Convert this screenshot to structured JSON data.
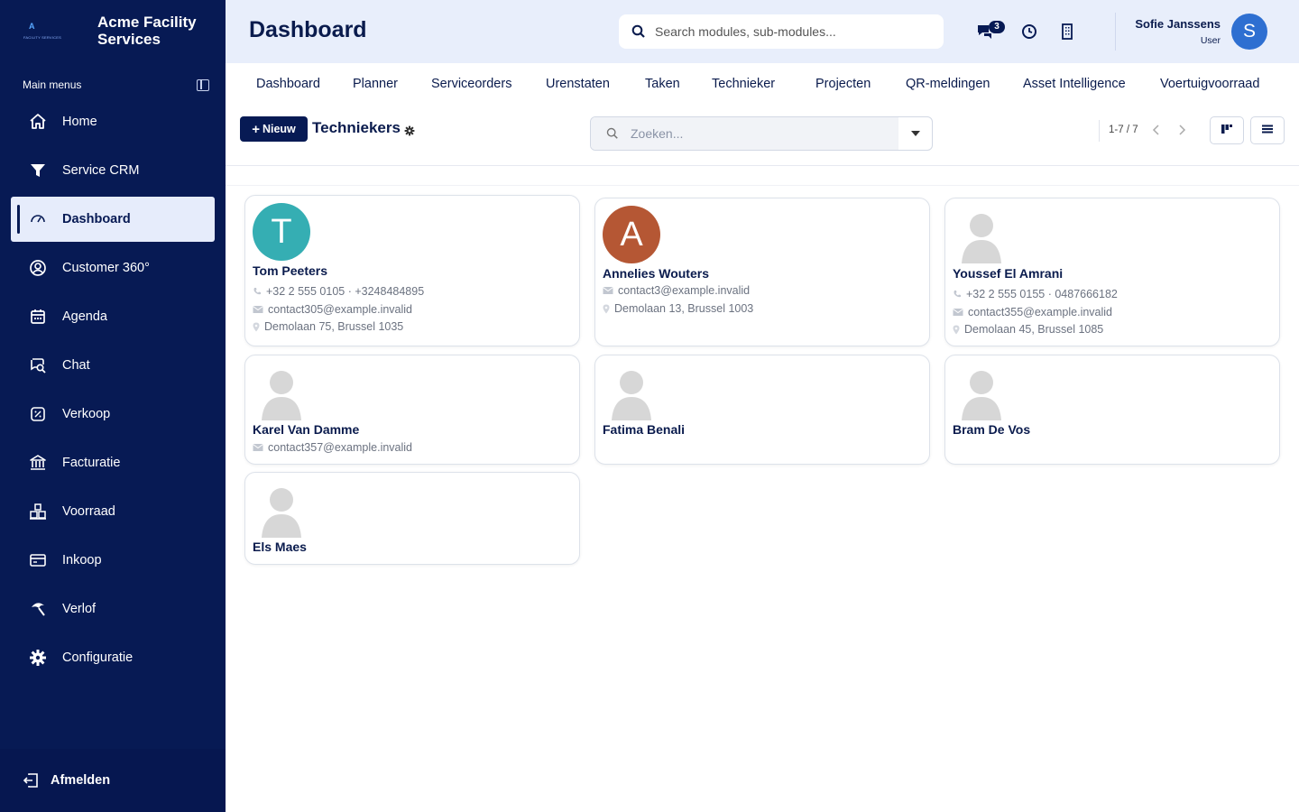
{
  "brand": {
    "logo_mark": "A",
    "logo_subtext": "FACILITY SERVICES",
    "name": "Acme Facility Services"
  },
  "sidebar": {
    "heading": "Main menus",
    "items": [
      {
        "label": "Home",
        "icon": "home-icon"
      },
      {
        "label": "Service CRM",
        "icon": "filter-icon"
      },
      {
        "label": "Dashboard",
        "icon": "gauge-icon",
        "active": true
      },
      {
        "label": "Customer 360°",
        "icon": "user-circle-icon"
      },
      {
        "label": "Agenda",
        "icon": "calendar-icon"
      },
      {
        "label": "Chat",
        "icon": "chat-search-icon"
      },
      {
        "label": "Verkoop",
        "icon": "percent-icon"
      },
      {
        "label": "Facturatie",
        "icon": "bank-icon"
      },
      {
        "label": "Voorraad",
        "icon": "boxes-icon"
      },
      {
        "label": "Inkoop",
        "icon": "card-icon"
      },
      {
        "label": "Verlof",
        "icon": "umbrella-icon"
      },
      {
        "label": "Configuratie",
        "icon": "gear-icon"
      }
    ],
    "logout_label": "Afmelden"
  },
  "header": {
    "title": "Dashboard",
    "search_placeholder": "Search modules, sub-modules...",
    "chat_badge": "3",
    "user_name": "Sofie Janssens",
    "user_role": "User",
    "avatar_initial": "S"
  },
  "tabs": [
    "Dashboard",
    "Planner",
    "Serviceorders",
    "Urenstaten",
    "Taken",
    "Technieker",
    "Projecten",
    "QR-meldingen",
    "Asset Intelligence",
    "Voertuigvoorraad"
  ],
  "controls": {
    "new_label": "Nieuw",
    "section_title": "Techniekers",
    "filter_placeholder": "Zoeken...",
    "pager": "1-7 / 7"
  },
  "technicians": [
    {
      "name": "Tom Peeters",
      "initial": "T",
      "avatar_color": "#35aeb3",
      "phone": "+32 2 555 0105 · +3248484895",
      "email": "contact305@example.invalid",
      "address": "Demolaan 75, Brussel 1035"
    },
    {
      "name": "Annelies Wouters",
      "initial": "A",
      "avatar_color": "#b55734",
      "phone": "",
      "email": "contact3@example.invalid",
      "address": "Demolaan 13, Brussel 1003"
    },
    {
      "name": "Youssef El Amrani",
      "initial": "",
      "avatar_color": "",
      "phone": "+32 2 555 0155 · 0487666182",
      "email": "contact355@example.invalid",
      "address": "Demolaan 45, Brussel 1085"
    },
    {
      "name": "Karel Van Damme",
      "initial": "",
      "avatar_color": "",
      "phone": "",
      "email": "contact357@example.invalid",
      "address": ""
    },
    {
      "name": "Fatima Benali",
      "initial": "",
      "avatar_color": "",
      "phone": "",
      "email": "",
      "address": ""
    },
    {
      "name": "Bram De Vos",
      "initial": "",
      "avatar_color": "",
      "phone": "",
      "email": "",
      "address": ""
    },
    {
      "name": "Els Maes",
      "initial": "",
      "avatar_color": "",
      "phone": "",
      "email": "",
      "address": ""
    }
  ]
}
